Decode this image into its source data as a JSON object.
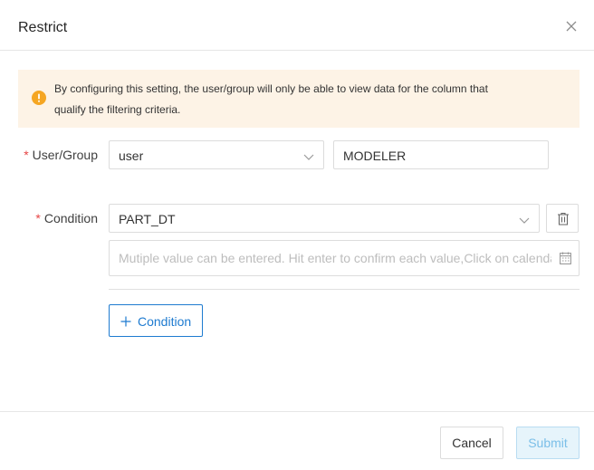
{
  "dialog": {
    "title": "Restrict",
    "close_icon": "close-icon"
  },
  "alert": {
    "icon": "warning-icon",
    "text_line1": "By configuring this setting, the user/group will only be able to view data for the column that",
    "text_line2": "qualify the filtering criteria.",
    "background": "#fdf3e6",
    "icon_color": "#f5a623"
  },
  "form": {
    "user_group": {
      "required_mark": "*",
      "label": "User/Group",
      "type_value": "user",
      "name_value": "MODELER"
    },
    "condition": {
      "required_mark": "*",
      "label": "Condition",
      "column_value": "PART_DT",
      "values_placeholder": "Mutiple value can be entered. Hit enter to confirm each value,Click on calendar",
      "delete_icon": "trash-icon",
      "calendar_icon": "calendar-icon"
    },
    "add_condition_label": "Condition"
  },
  "footer": {
    "cancel_label": "Cancel",
    "submit_label": "Submit"
  },
  "colors": {
    "accent": "#1e7bd0",
    "required": "#e64545",
    "submit_disabled_bg": "#e6f4fb",
    "submit_disabled_text": "#7bbfe8"
  }
}
